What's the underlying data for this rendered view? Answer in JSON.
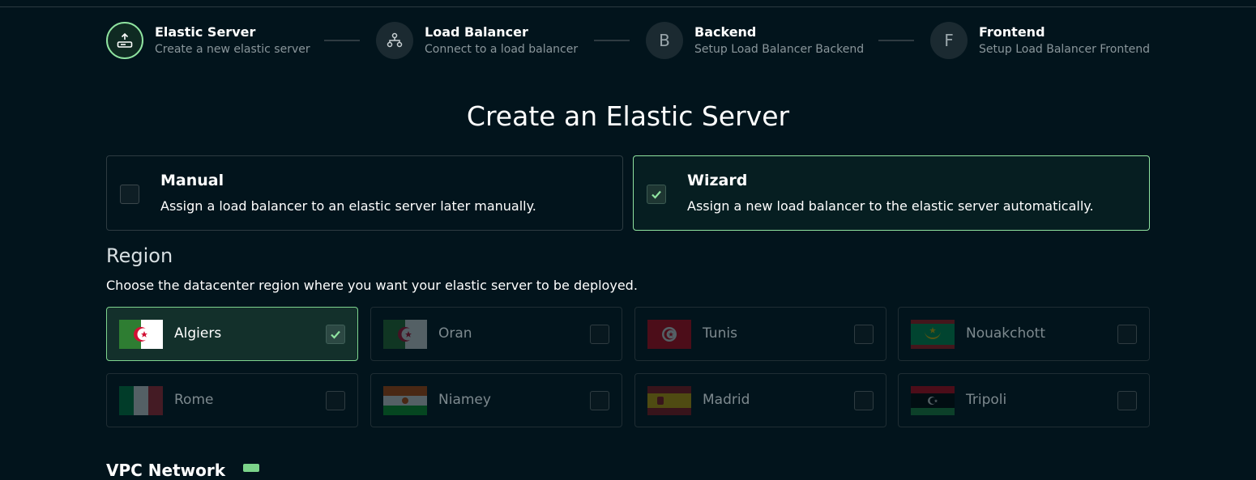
{
  "stepper": {
    "steps": [
      {
        "title": "Elastic Server",
        "subtitle": "Create a new elastic server",
        "icon": "upload-server-icon",
        "letter": ""
      },
      {
        "title": "Load Balancer",
        "subtitle": "Connect to a load balancer",
        "icon": "network-icon",
        "letter": ""
      },
      {
        "title": "Backend",
        "subtitle": "Setup Load Balancer Backend",
        "icon": "letter",
        "letter": "B"
      },
      {
        "title": "Frontend",
        "subtitle": "Setup Load Balancer Frontend",
        "icon": "letter",
        "letter": "F"
      }
    ]
  },
  "page": {
    "heading": "Create an Elastic Server"
  },
  "modes": [
    {
      "title": "Manual",
      "description": "Assign a load balancer to an elastic server later manually.",
      "selected": false
    },
    {
      "title": "Wizard",
      "description": "Assign a new load balancer to the elastic server automatically.",
      "selected": true
    }
  ],
  "region": {
    "title": "Region",
    "description": "Choose the datacenter region where you want your elastic server to be deployed.",
    "items": [
      {
        "name": "Algiers",
        "flag": "algeria",
        "selected": true
      },
      {
        "name": "Oran",
        "flag": "algeria",
        "selected": false
      },
      {
        "name": "Tunis",
        "flag": "tunisia",
        "selected": false
      },
      {
        "name": "Nouakchott",
        "flag": "mauritania",
        "selected": false
      },
      {
        "name": "Rome",
        "flag": "italy",
        "selected": false
      },
      {
        "name": "Niamey",
        "flag": "niger",
        "selected": false
      },
      {
        "name": "Madrid",
        "flag": "spain",
        "selected": false
      },
      {
        "name": "Tripoli",
        "flag": "libya",
        "selected": false
      }
    ]
  },
  "colors": {
    "background": "#02141c",
    "accent": "#8fe3a0",
    "selected_bg": "#13302b"
  },
  "next_section": {
    "title": "VPC Network"
  }
}
